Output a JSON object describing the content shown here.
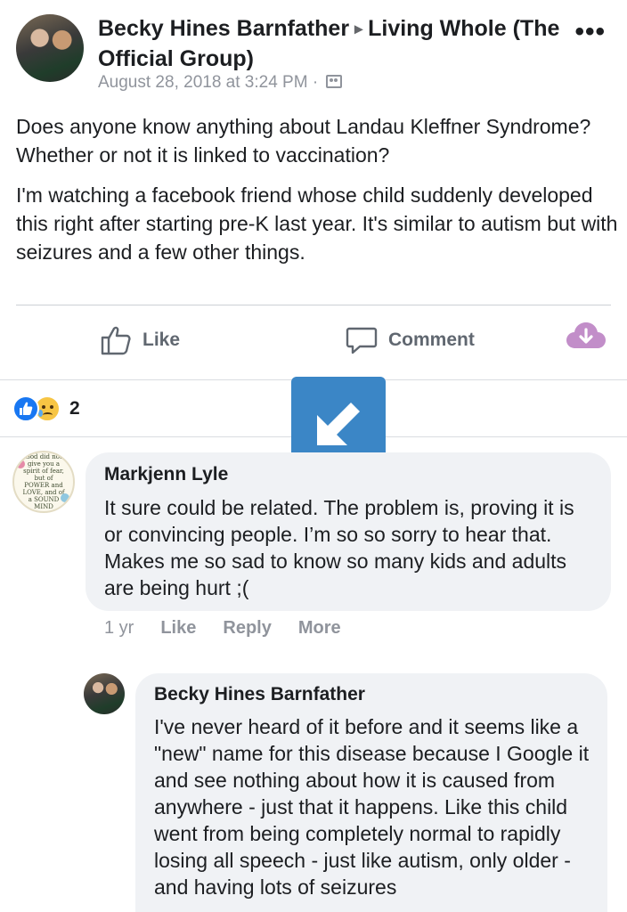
{
  "post": {
    "author": "Becky Hines Barnfather",
    "arrow": "▸",
    "group": "Living Whole (The Official Group)",
    "timestamp": "August 28, 2018 at 3:24 PM",
    "separator": "·",
    "more_icon": "•••",
    "body_p1": "Does anyone know anything about Landau Kleffner Syndrome? Whether or not it is linked to vaccination?",
    "body_p2": "I'm watching a facebook friend whose child suddenly developed this right after starting pre-K last year. It's similar to autism but with seizures and a few other things."
  },
  "actions": {
    "like_label": "Like",
    "comment_label": "Comment",
    "download_icon": "cloud-download-icon",
    "download_color": "#c28ec9"
  },
  "reactions": {
    "count": "2",
    "types": [
      "like",
      "sad"
    ]
  },
  "overlay": {
    "icon": "arrow-down-left-icon",
    "color": "#3b86c6"
  },
  "comments": [
    {
      "author": "Markjenn Lyle",
      "avatar_text": "God did not give you a spirit of fear, but of POWER and LOVE, and of a SOUND MIND",
      "text": "It sure could be related. The problem is, proving it is or convincing people. I’m so so sorry to hear that. Makes me so sad to know so many kids and adults are being hurt ;(",
      "time": "1 yr",
      "like_label": "Like",
      "reply_label": "Reply",
      "more_label": "More"
    }
  ],
  "reply": {
    "author": "Becky Hines Barnfather",
    "text": "I've never heard of it before and it seems like a \"new\" name for this disease because I Google it and see nothing about how it is caused from anywhere - just that it happens. Like this child went from being completely normal to rapidly losing all speech - just like autism, only older - and having lots of seizures"
  }
}
